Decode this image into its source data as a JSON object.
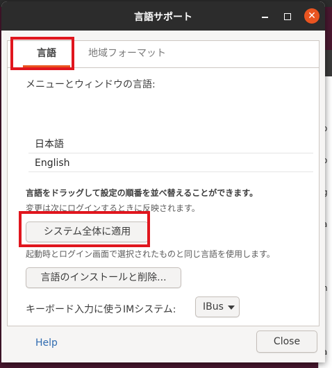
{
  "background": {
    "top_fragment": "",
    "right_chars": [
      "i",
      "o",
      "o",
      "g",
      "a",
      "i",
      "h",
      "i",
      "a"
    ]
  },
  "window": {
    "title": "言語サポート",
    "minimize_symbol": "",
    "maximize_symbol": "",
    "close_symbol": "✕"
  },
  "tabs": [
    {
      "label": "言語",
      "active": true
    },
    {
      "label": "地域フォーマット",
      "active": false
    }
  ],
  "language_tab": {
    "menu_label": "メニューとウィンドウの言語:",
    "languages": [
      "日本語",
      "English"
    ],
    "drag_hint": "言語をドラッグして設定の順番を並べ替えることができます。",
    "change_note": "変更は次にログインするときに反映されます。",
    "apply_button": "システム全体に適用",
    "apply_note": "起動時とログイン画面で選択されたものと同じ言語を使用します。",
    "install_button": "言語のインストールと削除...",
    "im_label": "キーボード入力に使うIMシステム:",
    "im_value": "IBus"
  },
  "footer": {
    "help": "Help",
    "close": "Close"
  },
  "colors": {
    "accent": "#e95420",
    "highlight_box": "#e0161e",
    "titlebar": "#2c2c2c",
    "link": "#2f6bb0"
  }
}
